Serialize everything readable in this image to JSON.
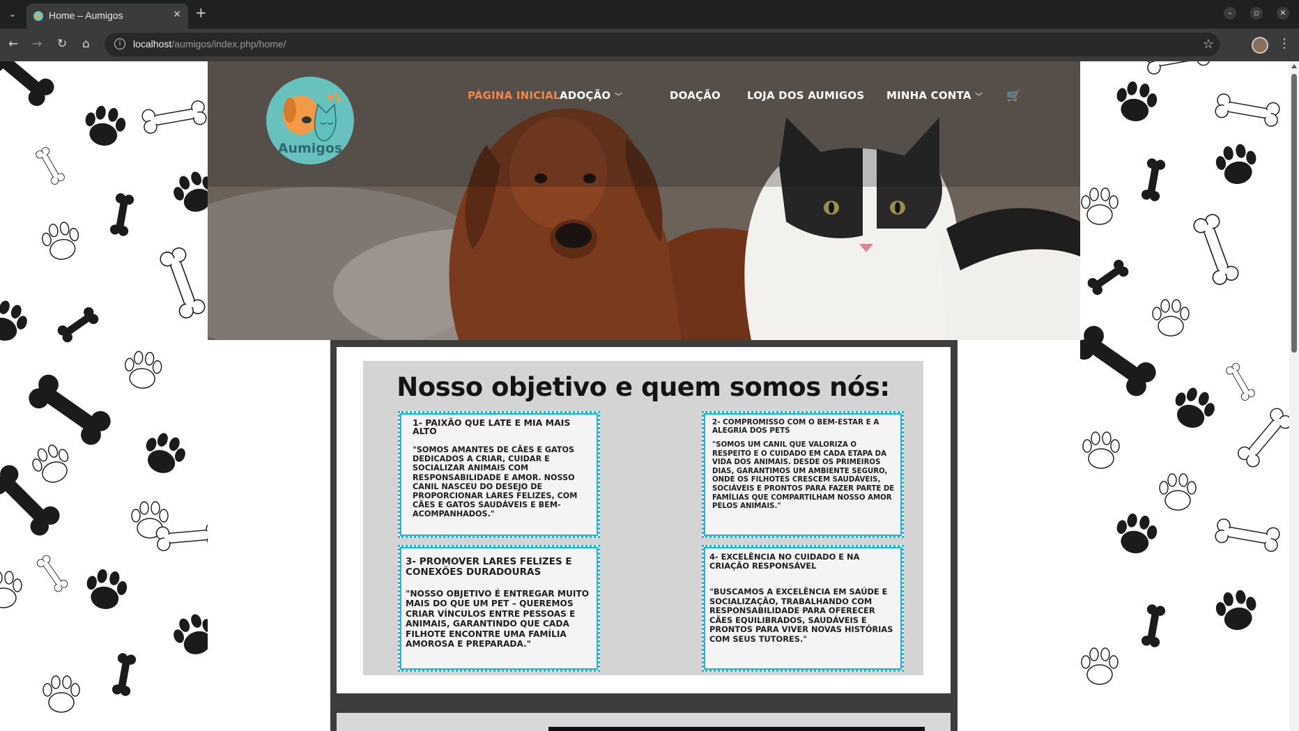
{
  "browser": {
    "tab_title": "Home – Aumigos",
    "url_host": "localhost",
    "url_path": "/aumigos/index.php/home/"
  },
  "site": {
    "logo_text": "Aumigos",
    "nav": [
      {
        "label": "PÁGINA INICIAL",
        "active": true
      },
      {
        "label": "ADOÇÃO",
        "has_dropdown": true
      },
      {
        "label": "DOAÇÃO"
      },
      {
        "label": "LOJA DOS AUMIGOS"
      },
      {
        "label": "MINHA CONTA",
        "has_dropdown": true
      }
    ],
    "accent_color": "#f2874a",
    "card_border_color": "#1fb7d8"
  },
  "poster": {
    "title": "Nosso objetivo e quem somos nós:",
    "cards": [
      {
        "heading": "1- PAIXÃO QUE LATE E MIA MAIS ALTO",
        "body": "\"SOMOS AMANTES DE CÃES E GATOS DEDICADOS A CRIAR, CUIDAR E SOCIALIZAR ANIMAIS COM RESPONSABILIDADE E AMOR. NOSSO CANIL NASCEU DO DESEJO DE PROPORCIONAR LARES FELIZES, COM CÃES E GATOS SAUDÁVEIS E BEM-ACOMPANHADOS.\""
      },
      {
        "heading": "2- COMPROMISSO COM O BEM-ESTAR E A ALEGRIA DOS PETS",
        "body": "\"SOMOS UM CANIL QUE VALORIZA O RESPEITO E O CUIDADO EM CADA ETAPA DA VIDA DOS ANIMAIS. DESDE OS PRIMEIROS DIAS, GARANTIMOS UM AMBIENTE SEGURO, ONDE OS FILHOTES CRESCEM SAUDÁVEIS, SOCIÁVEIS E PRONTOS PARA FAZER PARTE DE FAMÍLIAS QUE COMPARTILHAM NOSSO AMOR PELOS ANIMAIS.\""
      },
      {
        "heading": "3- PROMOVER LARES FELIZES E CONEXÕES DURADOURAS",
        "body": "\"NOSSO OBJETIVO É ENTREGAR MUITO MAIS DO QUE UM PET – QUEREMOS CRIAR VÍNCULOS ENTRE PESSOAS E ANIMAIS, GARANTINDO QUE CADA FILHOTE ENCONTRE UMA FAMÍLIA AMOROSA E PREPARADA.\""
      },
      {
        "heading": "4- EXCELÊNCIA NO CUIDADO E NA CRIAÇÃO RESPONSÁVEL",
        "body": "\"BUSCAMOS A EXCELÊNCIA EM SAÚDE E SOCIALIZAÇÃO, TRABALHANDO COM RESPONSABILIDADE PARA OFERECER CÃES EQUILIBRADOS, SAUDÁVEIS E PRONTOS PARA VIVER NOVAS HISTÓRIAS COM SEUS TUTORES.\""
      }
    ]
  }
}
